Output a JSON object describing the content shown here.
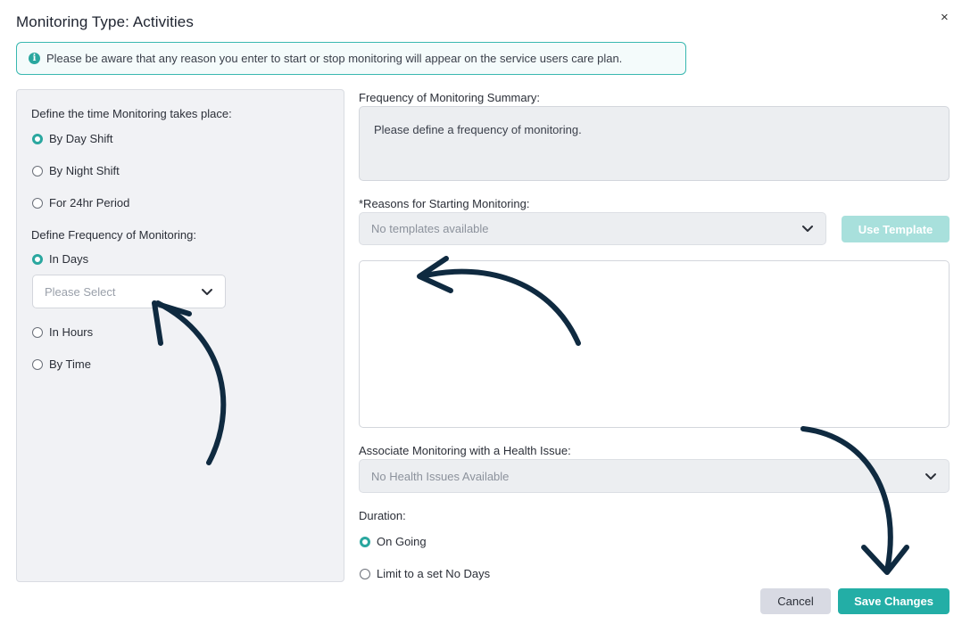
{
  "dialog": {
    "title": "Monitoring Type: Activities",
    "close_symbol": "×"
  },
  "info_banner": {
    "icon": "info-icon",
    "icon_glyph": "i",
    "text": "Please be aware that any reason you enter to start or stop monitoring will appear on the service users care plan."
  },
  "left_panel": {
    "time_label": "Define the time Monitoring takes place:",
    "time_options": [
      {
        "label": "By Day Shift",
        "checked": true
      },
      {
        "label": "By Night Shift",
        "checked": false
      },
      {
        "label": "For 24hr Period",
        "checked": false
      }
    ],
    "frequency_label": "Define Frequency of Monitoring:",
    "frequency_options": [
      {
        "label": "In Days",
        "checked": true
      },
      {
        "label": "In Hours",
        "checked": false
      },
      {
        "label": "By Time",
        "checked": false
      }
    ],
    "days_select_placeholder": "Please Select"
  },
  "right_panel": {
    "summary_label": "Frequency of Monitoring Summary:",
    "summary_text": "Please define a frequency of monitoring.",
    "reasons_label": "*Reasons for Starting Monitoring:",
    "template_select_value": "No templates available",
    "use_template_label": "Use Template",
    "reason_text": "",
    "health_label": "Associate Monitoring with a Health Issue:",
    "health_select_value": "No Health Issues Available",
    "duration_label": "Duration:",
    "duration_options": [
      {
        "label": "On Going",
        "checked": true
      },
      {
        "label": "Limit to a set No Days",
        "checked": false
      }
    ]
  },
  "footer": {
    "cancel_label": "Cancel",
    "save_label": "Save Changes"
  },
  "colors": {
    "accent": "#2aa79f",
    "save_button": "#23aea6",
    "use_template_disabled": "#a8e0dc",
    "annotation_arrow": "#0f2a40"
  }
}
